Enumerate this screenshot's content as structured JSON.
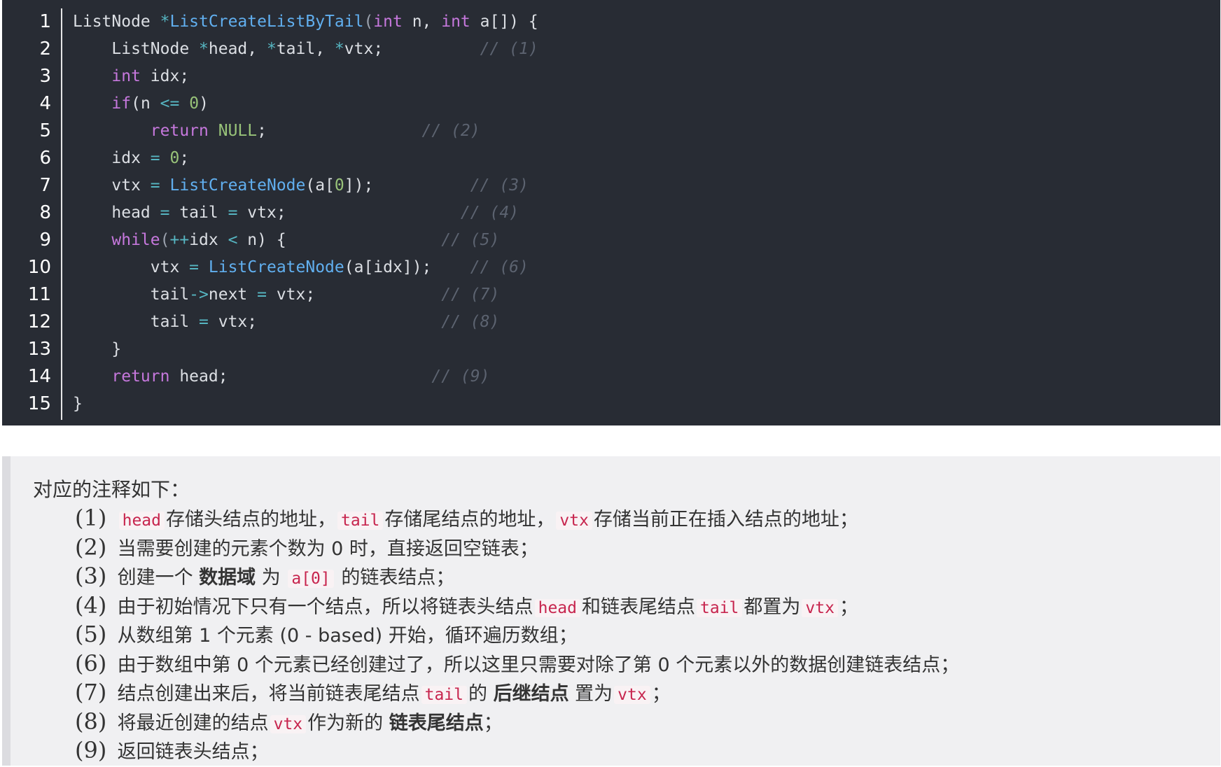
{
  "code": {
    "line_numbers": [
      "1",
      "2",
      "3",
      "4",
      "5",
      "6",
      "7",
      "8",
      "9",
      "10",
      "11",
      "12",
      "13",
      "14",
      "15"
    ],
    "lines": [
      [
        {
          "t": "ListNode ",
          "c": "t"
        },
        {
          "t": "*",
          "c": "o"
        },
        {
          "t": "ListCreateListByTail",
          "c": "f"
        },
        {
          "t": "(",
          "c": "p"
        },
        {
          "t": "int",
          "c": "k"
        },
        {
          "t": " n, ",
          "c": "t"
        },
        {
          "t": "int",
          "c": "k"
        },
        {
          "t": " a[]) {",
          "c": "t"
        }
      ],
      [
        {
          "t": "    ListNode ",
          "c": "t"
        },
        {
          "t": "*",
          "c": "o"
        },
        {
          "t": "head, ",
          "c": "t"
        },
        {
          "t": "*",
          "c": "o"
        },
        {
          "t": "tail, ",
          "c": "t"
        },
        {
          "t": "*",
          "c": "o"
        },
        {
          "t": "vtx;",
          "c": "t"
        },
        {
          "t": "          // (1)",
          "c": "c"
        }
      ],
      [
        {
          "t": "    ",
          "c": "t"
        },
        {
          "t": "int",
          "c": "k"
        },
        {
          "t": " idx;",
          "c": "t"
        }
      ],
      [
        {
          "t": "    ",
          "c": "t"
        },
        {
          "t": "if",
          "c": "k"
        },
        {
          "t": "(n ",
          "c": "t"
        },
        {
          "t": "<=",
          "c": "o"
        },
        {
          "t": " ",
          "c": "t"
        },
        {
          "t": "0",
          "c": "n"
        },
        {
          "t": ")",
          "c": "t"
        }
      ],
      [
        {
          "t": "        ",
          "c": "t"
        },
        {
          "t": "return",
          "c": "k"
        },
        {
          "t": " ",
          "c": "t"
        },
        {
          "t": "NULL",
          "c": "n"
        },
        {
          "t": ";",
          "c": "t"
        },
        {
          "t": "                // (2)",
          "c": "c"
        }
      ],
      [
        {
          "t": "    idx ",
          "c": "t"
        },
        {
          "t": "=",
          "c": "o"
        },
        {
          "t": " ",
          "c": "t"
        },
        {
          "t": "0",
          "c": "n"
        },
        {
          "t": ";",
          "c": "t"
        }
      ],
      [
        {
          "t": "    vtx ",
          "c": "t"
        },
        {
          "t": "=",
          "c": "o"
        },
        {
          "t": " ",
          "c": "t"
        },
        {
          "t": "ListCreateNode",
          "c": "f"
        },
        {
          "t": "(a[",
          "c": "t"
        },
        {
          "t": "0",
          "c": "n"
        },
        {
          "t": "]);",
          "c": "t"
        },
        {
          "t": "          // (3)",
          "c": "c"
        }
      ],
      [
        {
          "t": "    head ",
          "c": "t"
        },
        {
          "t": "=",
          "c": "o"
        },
        {
          "t": " tail ",
          "c": "t"
        },
        {
          "t": "=",
          "c": "o"
        },
        {
          "t": " vtx;",
          "c": "t"
        },
        {
          "t": "                  // (4)",
          "c": "c"
        }
      ],
      [
        {
          "t": "    ",
          "c": "t"
        },
        {
          "t": "while",
          "c": "k"
        },
        {
          "t": "(",
          "c": "p"
        },
        {
          "t": "++",
          "c": "o"
        },
        {
          "t": "idx ",
          "c": "t"
        },
        {
          "t": "<",
          "c": "o"
        },
        {
          "t": " n) {",
          "c": "t"
        },
        {
          "t": "                // (5)",
          "c": "c"
        }
      ],
      [
        {
          "t": "        vtx ",
          "c": "t"
        },
        {
          "t": "=",
          "c": "o"
        },
        {
          "t": " ",
          "c": "t"
        },
        {
          "t": "ListCreateNode",
          "c": "f"
        },
        {
          "t": "(a[idx]);",
          "c": "t"
        },
        {
          "t": "    // (6)",
          "c": "c"
        }
      ],
      [
        {
          "t": "        tail",
          "c": "t"
        },
        {
          "t": "->",
          "c": "o"
        },
        {
          "t": "next ",
          "c": "t"
        },
        {
          "t": "=",
          "c": "o"
        },
        {
          "t": " vtx;",
          "c": "t"
        },
        {
          "t": "             // (7)",
          "c": "c"
        }
      ],
      [
        {
          "t": "        tail ",
          "c": "t"
        },
        {
          "t": "=",
          "c": "o"
        },
        {
          "t": " vtx;",
          "c": "t"
        },
        {
          "t": "                   // (8)",
          "c": "c"
        }
      ],
      [
        {
          "t": "    }",
          "c": "t"
        }
      ],
      [
        {
          "t": "    ",
          "c": "t"
        },
        {
          "t": "return",
          "c": "k"
        },
        {
          "t": " head;",
          "c": "t"
        },
        {
          "t": "                     // (9)",
          "c": "c"
        }
      ],
      [
        {
          "t": "}",
          "c": "t"
        }
      ]
    ]
  },
  "notes": {
    "title": "对应的注释如下：",
    "items": [
      {
        "num": "(1)",
        "parts": [
          {
            "x": " "
          },
          {
            "ic": "head"
          },
          {
            "x": "存储头结点的地址，"
          },
          {
            "ic": "tail"
          },
          {
            "x": "存储尾结点的地址，"
          },
          {
            "ic": "vtx"
          },
          {
            "x": "存储当前正在插入结点的地址；"
          }
        ]
      },
      {
        "num": "(2)",
        "parts": [
          {
            "x": " 当需要创建的元素个数为 0 时，直接返回空链表；"
          }
        ]
      },
      {
        "num": "(3)",
        "parts": [
          {
            "x": " 创建一个 "
          },
          {
            "b": "数据域"
          },
          {
            "x": " 为 "
          },
          {
            "ic": "a[0]"
          },
          {
            "x": " 的链表结点；"
          }
        ]
      },
      {
        "num": "(4)",
        "parts": [
          {
            "x": " 由于初始情况下只有一个结点，所以将链表头结点"
          },
          {
            "ic": "head"
          },
          {
            "x": "和链表尾结点"
          },
          {
            "ic": "tail"
          },
          {
            "x": "都置为"
          },
          {
            "ic": "vtx"
          },
          {
            "x": "；"
          }
        ]
      },
      {
        "num": "(5)",
        "parts": [
          {
            "x": " 从数组第 1 个元素 (0 - based) 开始，循环遍历数组；"
          }
        ]
      },
      {
        "num": "(6)",
        "parts": [
          {
            "x": " 由于数组中第 0 个元素已经创建过了，所以这里只需要对除了第 0 个元素以外的数据创建链表结点；"
          }
        ]
      },
      {
        "num": "(7)",
        "parts": [
          {
            "x": " 结点创建出来后，将当前链表尾结点"
          },
          {
            "ic": "tail"
          },
          {
            "x": "的 "
          },
          {
            "b": "后继结点"
          },
          {
            "x": " 置为"
          },
          {
            "ic": "vtx"
          },
          {
            "x": "；"
          }
        ]
      },
      {
        "num": "(8)",
        "parts": [
          {
            "x": " 将最近创建的结点"
          },
          {
            "ic": "vtx"
          },
          {
            "x": "作为新的 "
          },
          {
            "b": "链表尾结点"
          },
          {
            "x": "；"
          }
        ]
      },
      {
        "num": "(9)",
        "parts": [
          {
            "x": " 返回链表头结点；"
          }
        ]
      }
    ]
  }
}
